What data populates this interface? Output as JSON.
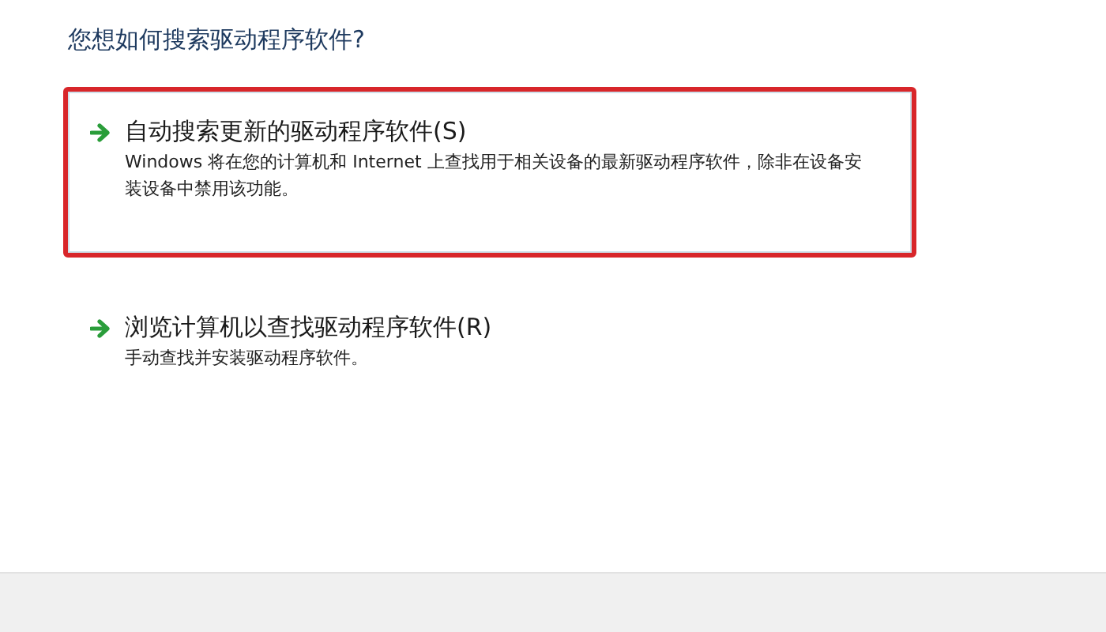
{
  "heading": "您想如何搜索驱动程序软件?",
  "options": [
    {
      "title": "自动搜索更新的驱动程序软件(S)",
      "description": "Windows 将在您的计算机和 Internet 上查找用于相关设备的最新驱动程序软件，除非在设备安装设备中禁用该功能。",
      "highlighted": true
    },
    {
      "title": "浏览计算机以查找驱动程序软件(R)",
      "description": "手动查找并安装驱动程序软件。",
      "highlighted": false
    }
  ]
}
